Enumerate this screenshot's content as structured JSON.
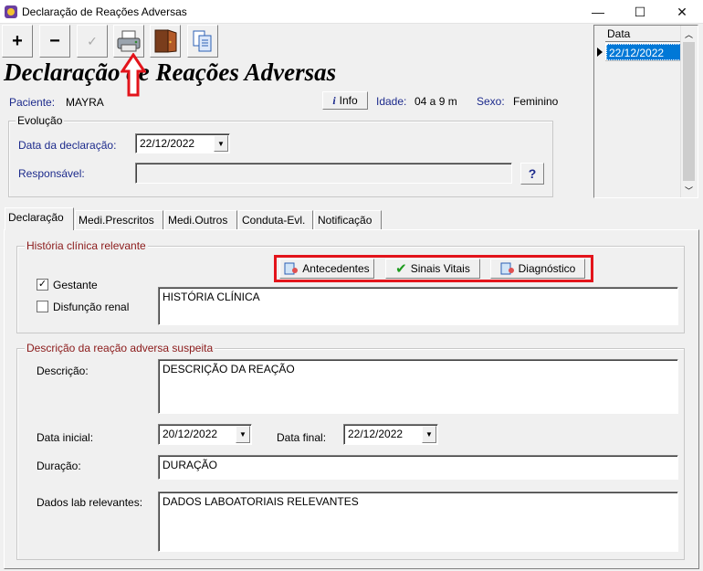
{
  "window": {
    "title": "Declaração de Reações Adversas",
    "minimize": "—",
    "maximize": "☐",
    "close": "✕"
  },
  "toolbar": {
    "add": "+",
    "remove": "−",
    "check": "✓",
    "print_icon": "printer-icon",
    "exit_icon": "door-exit-icon",
    "copy_icon": "copy-icon"
  },
  "form_title": "Declaração de Reações Adversas",
  "patient": {
    "label": "Paciente:",
    "name": "MAYRA",
    "info_button": "Info",
    "age_label": "Idade:",
    "age": "04 a 9 m",
    "sex_label": "Sexo:",
    "sex": "Feminino"
  },
  "evolucao": {
    "caption": "Evolução",
    "date_label": "Data da declaração:",
    "date_value": "22/12/2022",
    "resp_label": "Responsável:",
    "resp_value": "",
    "search_button": "?"
  },
  "grid": {
    "header": "Data",
    "rows": [
      "22/12/2022"
    ]
  },
  "tabs": [
    "Declaração",
    "Medi.Prescritos",
    "Medi.Outros",
    "Conduta-Evl.",
    "Notificação"
  ],
  "historia": {
    "caption": "História clínica relevante",
    "buttons": {
      "antecedentes": "Antecedentes",
      "sinais": "Sinais Vitais",
      "diagnostico": "Diagnóstico"
    },
    "gestante_label": "Gestante",
    "gestante_checked": true,
    "renal_label": "Disfunção renal",
    "renal_checked": false,
    "text": "HISTÓRIA CLÍNICA"
  },
  "reacao": {
    "caption": "Descrição da reação adversa suspeita",
    "desc_label": "Descrição:",
    "desc_value": "DESCRIÇÃO DA REAÇÃO",
    "start_label": "Data inicial:",
    "start_value": "20/12/2022",
    "end_label": "Data final:",
    "end_value": "22/12/2022",
    "duration_label": "Duração:",
    "duration_value": "DURAÇÃO",
    "lab_label": "Dados lab relevantes:",
    "lab_value": "DADOS LABOATORIAIS RELEVANTES"
  },
  "colors": {
    "highlight": "#e3141b",
    "label_blue": "#1c2a8c",
    "caption_red": "#8b1a1a",
    "selection": "#0078d7"
  }
}
